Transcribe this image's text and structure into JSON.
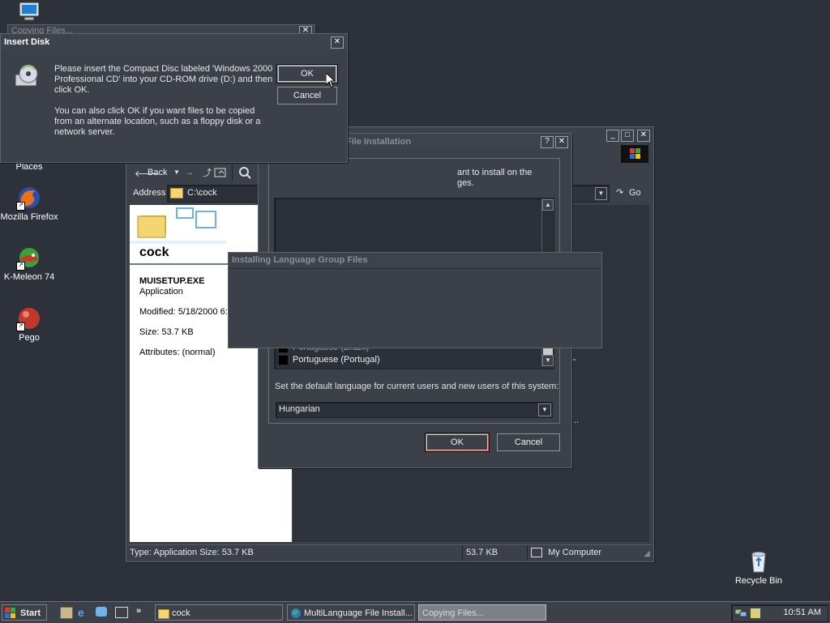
{
  "desktop": {
    "icons": [
      {
        "label": "Places"
      },
      {
        "label": "Mozilla Firefox"
      },
      {
        "label": "K-Meleon 74"
      },
      {
        "label": "Pego"
      },
      {
        "label": "Recycle Bin"
      }
    ]
  },
  "background_window": {
    "title": "Copying Files..."
  },
  "explorer": {
    "toolbar": {
      "back": "Back",
      "go": "Go"
    },
    "address": {
      "label": "Address",
      "value": "C:\\cock"
    },
    "folder_title": "cock",
    "file": {
      "name": "MUISETUP.EXE",
      "type": "Application",
      "modified": "Modified: 5/18/2000 6:",
      "size": "Size: 53.7 KB",
      "attributes": "Attributes: (normal)"
    },
    "right_pane_ellipsis": "...",
    "status": {
      "info": "Type: Application Size: 53.7 KB",
      "size": "53.7 KB",
      "zone": "My Computer"
    }
  },
  "mlang_dialog": {
    "title": "File Installation",
    "instruction_line1": "ant to install on the",
    "instruction_line2": "ges.",
    "list_items": [
      {
        "label": "Portuguese (Brazil)"
      },
      {
        "label": "Portuguese (Portugal)"
      }
    ],
    "default_lang_label": "Set the default language for current users and new users of this system:",
    "default_lang_value": "Hungarian",
    "ok": "OK",
    "cancel": "Cancel"
  },
  "progress_dialog": {
    "title": "Installing Language Group Files"
  },
  "insert_disk": {
    "title": "Insert Disk",
    "message1": "Please insert the Compact Disc labeled 'Windows 2000 Professional CD' into your CD-ROM drive (D:) and then click OK.",
    "message2": "You can also click OK if you want files to be copied from an alternate location, such as a floppy disk or a network server.",
    "ok": "OK",
    "cancel": "Cancel"
  },
  "taskbar": {
    "start": "Start",
    "quicklaunch_more": "»",
    "tasks": [
      {
        "label": "cock"
      },
      {
        "label": "MultiLanguage File Install..."
      },
      {
        "label": "Copying Files..."
      }
    ],
    "clock": "10:51 AM"
  },
  "colors": {
    "desktop": "#2d323a",
    "window": "#3b4049",
    "ok_border": "#c85a4b"
  }
}
